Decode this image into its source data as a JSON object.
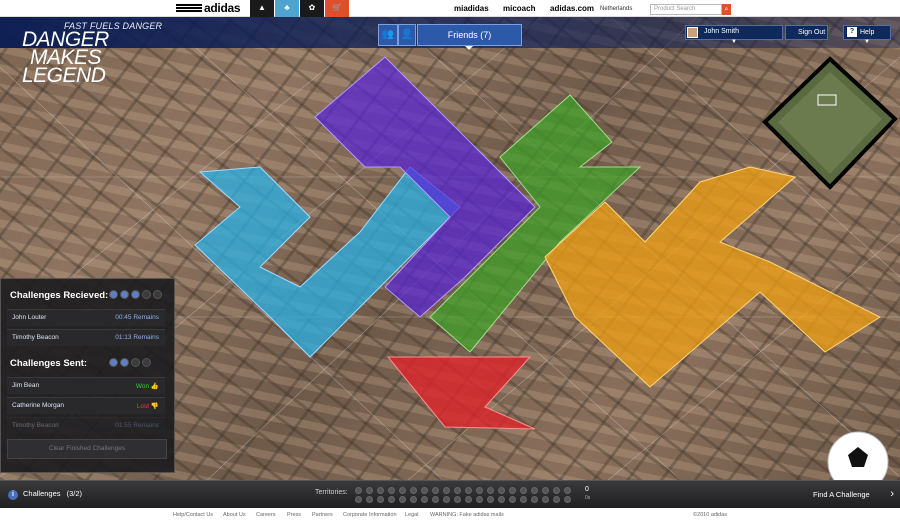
{
  "topbar": {
    "brand": "adidas",
    "links": {
      "miadidas": "miadidas",
      "micoach": "micoach",
      "adidas_com": "adidas.com",
      "locale": "Netherlands"
    },
    "search_placeholder": "Product Search",
    "search_icon": "search-icon",
    "colors": {
      "tile1": "#1a1a1a",
      "tile2": "#4fa3d1",
      "tile3": "#1a1a1a",
      "tile4": "#9a9a9a",
      "tile5": "#e04f2c"
    }
  },
  "header": {
    "tagline": "FAST FUELS DANGER",
    "title_lines": [
      "DANGER",
      "MAKES",
      "LEGEND"
    ],
    "friends_tab": "Friends (7)",
    "user_name": "John Smith",
    "sign_out": "Sign Out",
    "help": "Help"
  },
  "territories_colors": {
    "blue": "#2ab0e6",
    "purple": "#5a26d8",
    "green": "#3fa428",
    "orange": "#f0a012",
    "red": "#e0242a"
  },
  "panel": {
    "received_title": "Challenges Recieved:",
    "received_dots": [
      true,
      true,
      true,
      false,
      false
    ],
    "received": [
      {
        "name": "John Louter",
        "status": "00:45 Remains"
      },
      {
        "name": "Timothy Beacon",
        "status": "01:13 Remains"
      }
    ],
    "sent_title": "Challenges Sent:",
    "sent_dots": [
      true,
      true,
      false,
      false
    ],
    "sent": [
      {
        "name": "Jim Bean",
        "status": "Won",
        "color": "#3ec93e"
      },
      {
        "name": "Catherine Morgan",
        "status": "Lost",
        "color": "#e0413a"
      },
      {
        "name": "Timothy Beacon",
        "status": "01:55 Remains",
        "color": "#8fb0f0"
      }
    ],
    "clear_button": "Clear Finished Challenges"
  },
  "bottom": {
    "challenges_label": "Challenges",
    "challenges_count": "(3/2)",
    "territories_label": "Territories:",
    "territories_value_top": "0",
    "territories_value_bottom": "0s",
    "territory_slots": 40,
    "find_challenge": "Find A Challenge"
  },
  "footer": {
    "links": [
      "Help/Contact Us",
      "About Us",
      "Careers",
      "Press",
      "Partners",
      "Corporate Information",
      "Legal",
      "WARNING: Fake adidas mails"
    ],
    "copyright": "©2010 adidas"
  }
}
